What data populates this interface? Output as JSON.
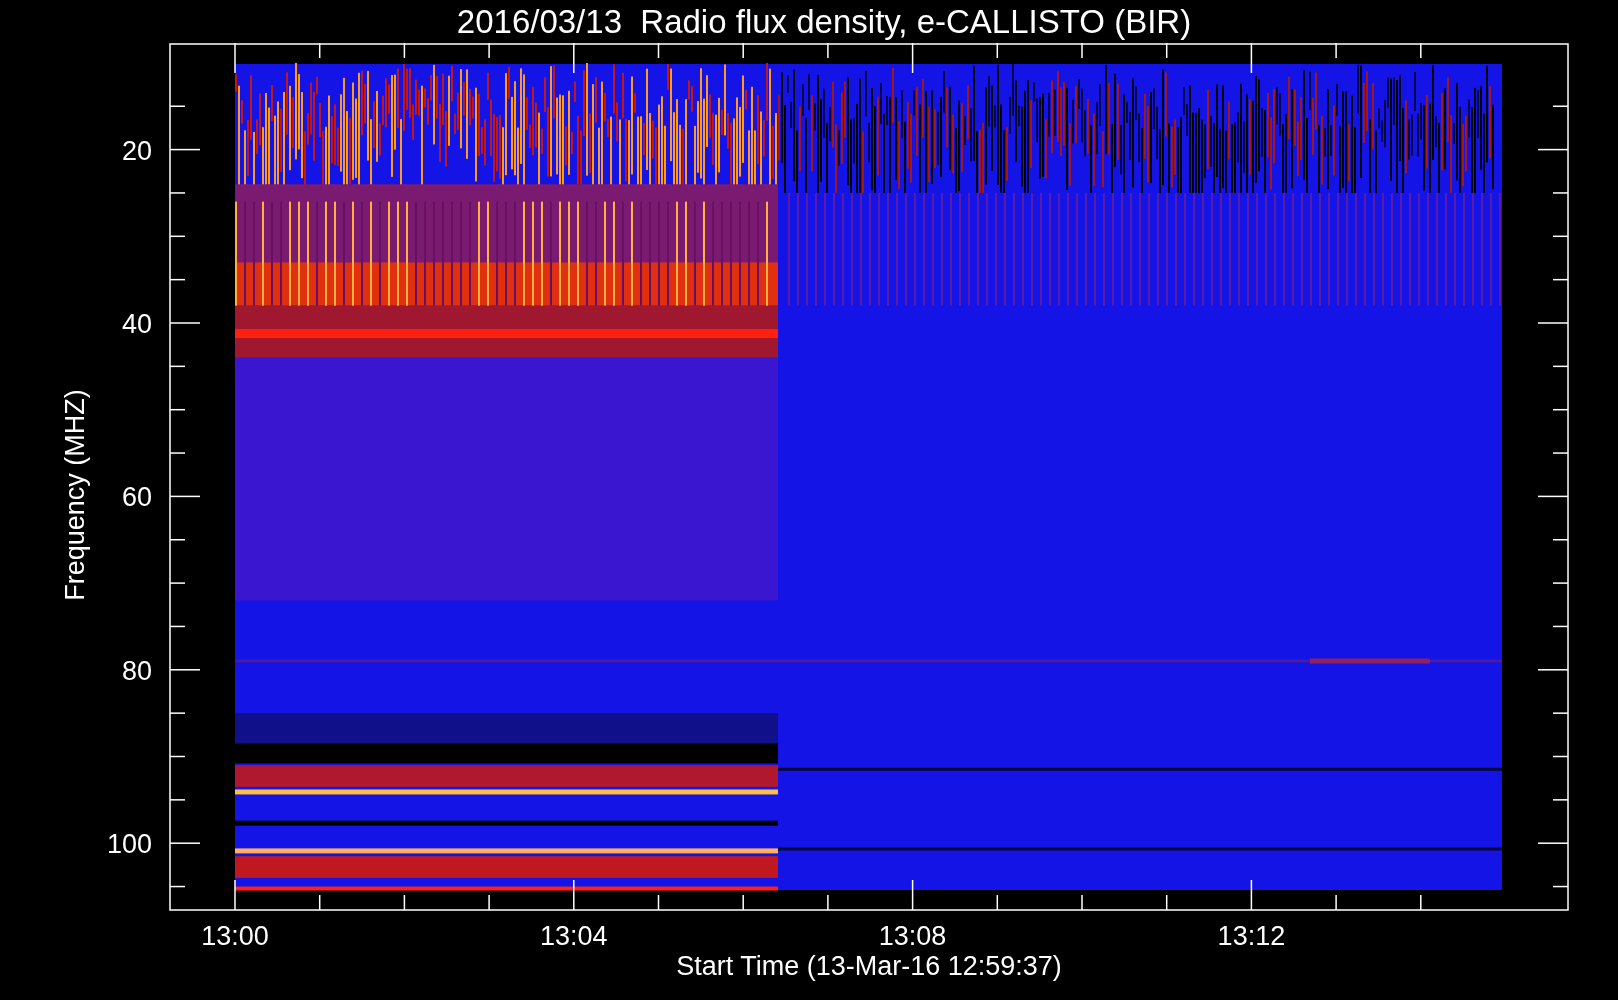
{
  "title": "2016/03/13  Radio flux density, e-CALLISTO (BIR)",
  "plot": {
    "ylabel": "Frequency (MHZ)",
    "xlabel": "Start Time (13-Mar-16 12:59:37)",
    "yticks": [
      "20",
      "40",
      "60",
      "80",
      "100"
    ],
    "xticks": [
      "13:00",
      "13:04",
      "13:08",
      "13:12"
    ]
  }
}
